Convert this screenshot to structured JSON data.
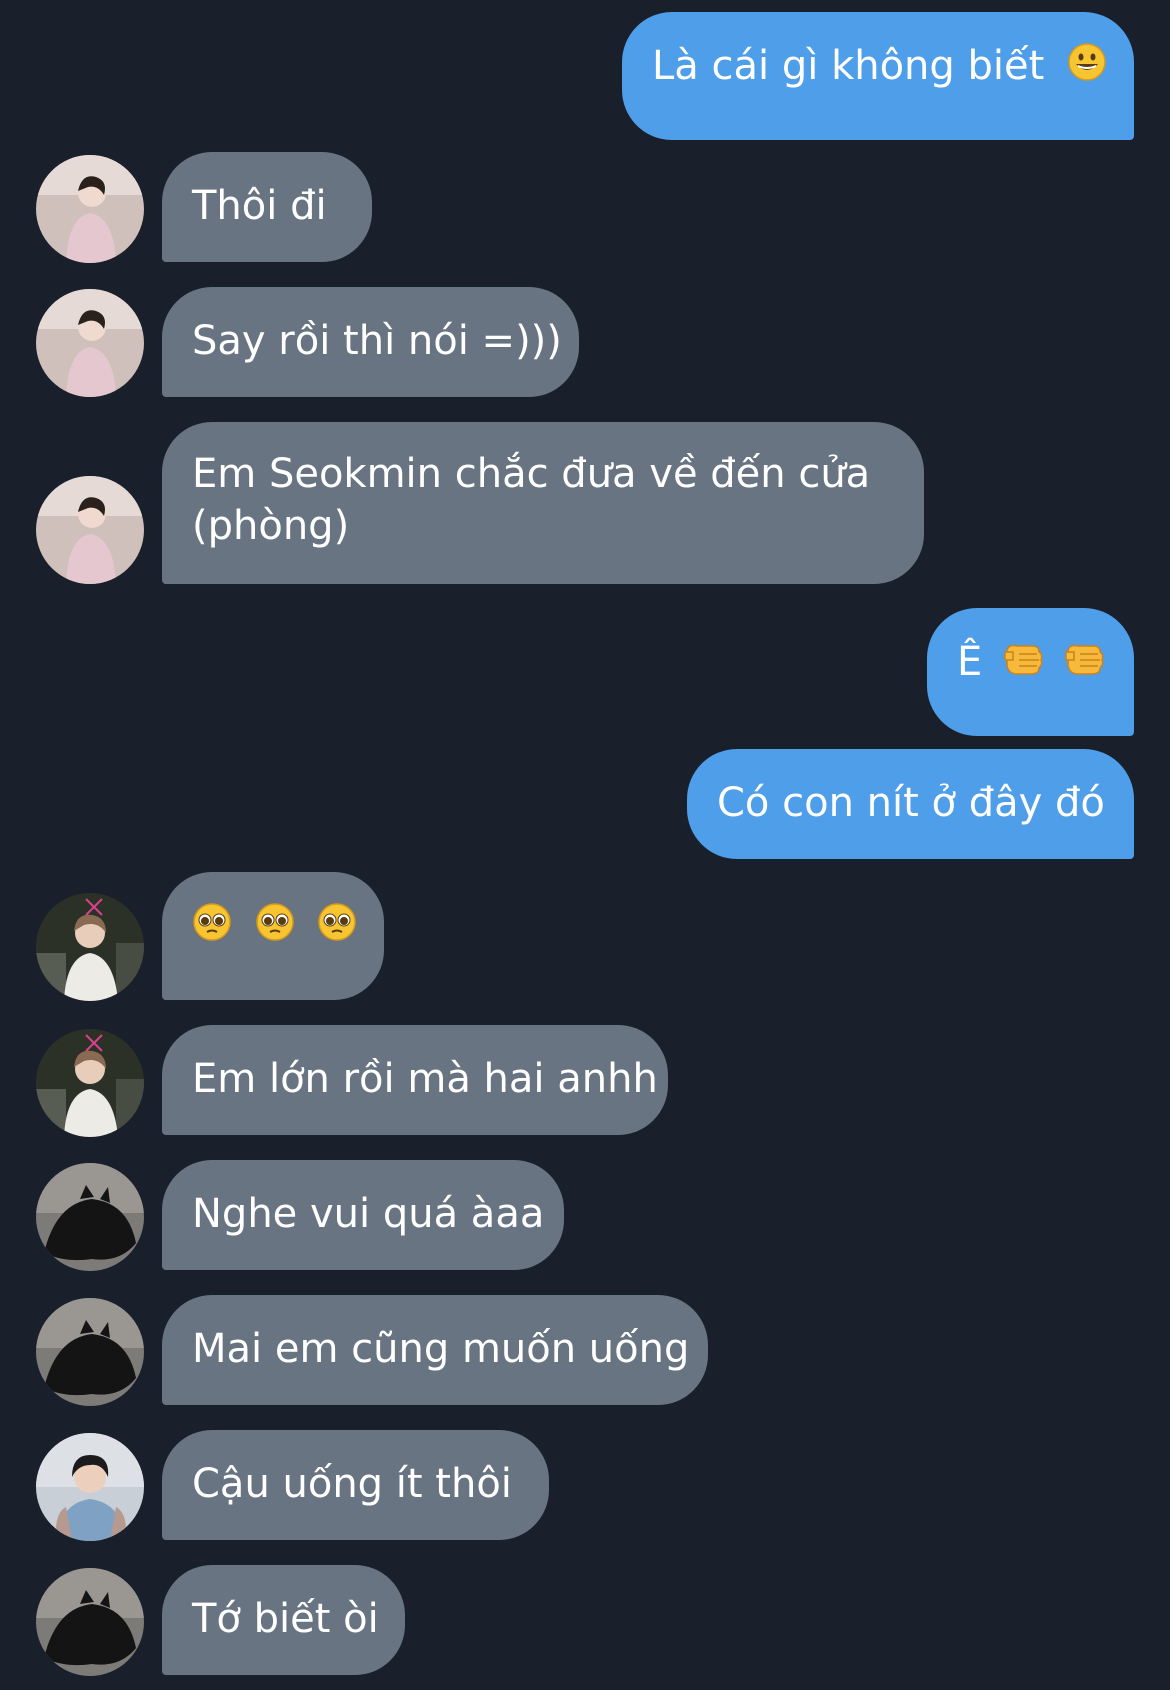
{
  "messages": [
    {
      "direction": "out",
      "text": "Là cái gì không biết",
      "emoji": "grinning-face"
    },
    {
      "direction": "in",
      "sender": "pink-sweater-user",
      "text": "Thôi đi"
    },
    {
      "direction": "in",
      "sender": "pink-sweater-user",
      "text": "Say rồi thì nói =)))"
    },
    {
      "direction": "in",
      "sender": "pink-sweater-user",
      "text": "Em Seokmin chắc đưa về đến cửa (phòng)"
    },
    {
      "direction": "out",
      "text": "Ê",
      "emoji": "pointing-fist x2"
    },
    {
      "direction": "out",
      "text": "Có con nít ở đây đó"
    },
    {
      "direction": "in",
      "sender": "white-shirt-user",
      "text": "",
      "emoji": "pleading-face x3"
    },
    {
      "direction": "in",
      "sender": "white-shirt-user",
      "text": "Em lớn rồi mà hai anhh"
    },
    {
      "direction": "in",
      "sender": "black-cat-user",
      "text": "Nghe vui quá àaa"
    },
    {
      "direction": "in",
      "sender": "black-cat-user",
      "text": "Mai em cũng muốn uống"
    },
    {
      "direction": "in",
      "sender": "blue-shirt-user",
      "text": "Cậu uống ít thôi"
    },
    {
      "direction": "in",
      "sender": "black-cat-user",
      "text": "Tớ biết òi"
    }
  ],
  "colors": {
    "background": "#19202b",
    "outgoing_bubble": "#4f9eea",
    "incoming_bubble": "#687482",
    "text": "#ffffff"
  }
}
